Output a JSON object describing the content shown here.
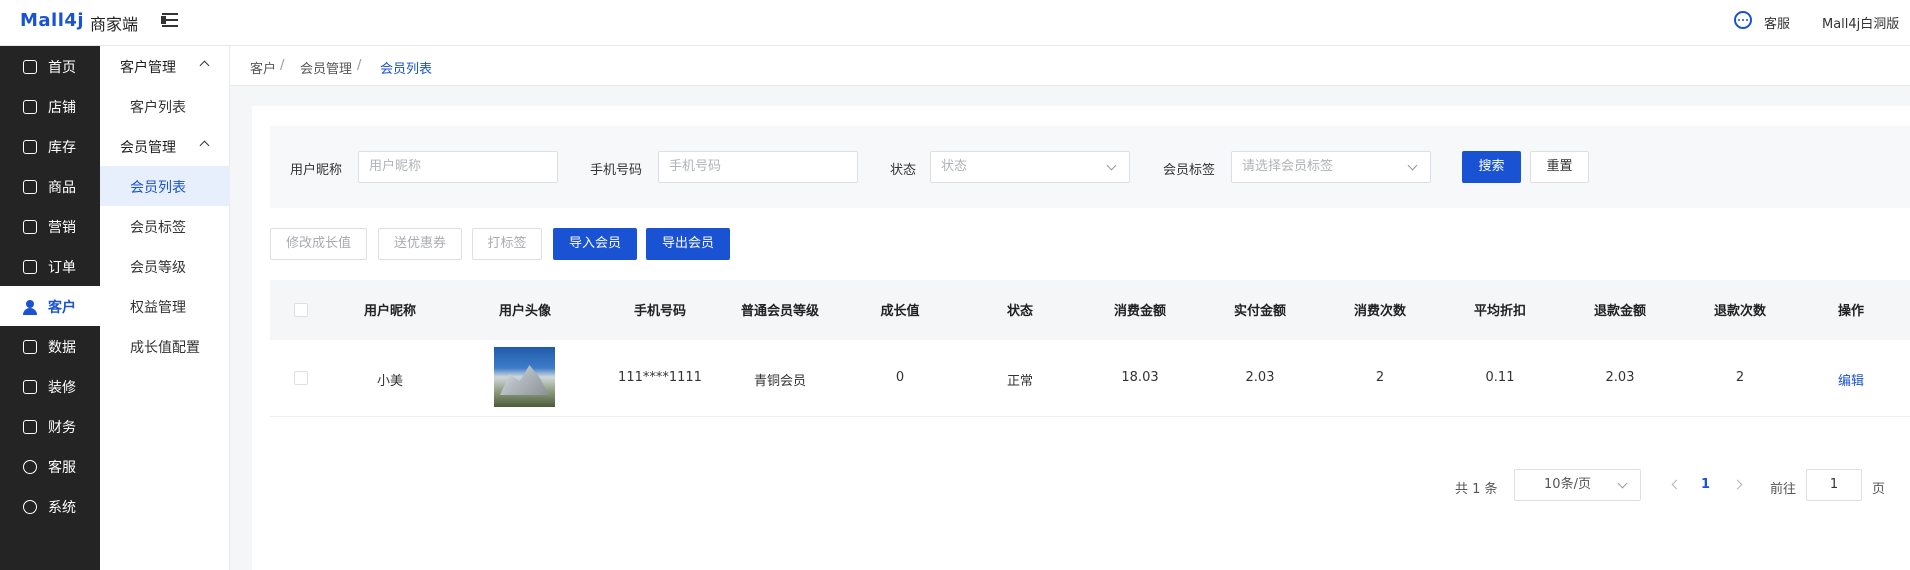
{
  "header": {
    "logo": "Mall4j",
    "subtitle": "商家端",
    "customer_service": "客服",
    "version": "Mall4j白洞版"
  },
  "main_nav": [
    {
      "label": "首页",
      "icon": "home-icon"
    },
    {
      "label": "店铺",
      "icon": "store-icon"
    },
    {
      "label": "库存",
      "icon": "inventory-icon"
    },
    {
      "label": "商品",
      "icon": "product-icon"
    },
    {
      "label": "营销",
      "icon": "gift-icon"
    },
    {
      "label": "订单",
      "icon": "order-icon"
    },
    {
      "label": "客户",
      "icon": "user-icon"
    },
    {
      "label": "数据",
      "icon": "chart-icon"
    },
    {
      "label": "装修",
      "icon": "decorate-icon"
    },
    {
      "label": "财务",
      "icon": "finance-icon"
    },
    {
      "label": "客服",
      "icon": "chat-icon"
    },
    {
      "label": "系统",
      "icon": "settings-icon"
    }
  ],
  "sub_nav": {
    "group1": "客户管理",
    "group1_items": [
      "客户列表"
    ],
    "group2": "会员管理",
    "group2_items": [
      "会员列表",
      "会员标签",
      "会员等级",
      "权益管理",
      "成长值配置"
    ]
  },
  "breadcrumb": [
    "客户",
    "/",
    "会员管理",
    "/",
    "会员列表"
  ],
  "filters": {
    "nickname_label": "用户昵称",
    "nickname_placeholder": "用户昵称",
    "phone_label": "手机号码",
    "phone_placeholder": "手机号码",
    "status_label": "状态",
    "status_placeholder": "状态",
    "tag_label": "会员标签",
    "tag_placeholder": "请选择会员标签",
    "search_btn": "搜索",
    "reset_btn": "重置"
  },
  "actions": {
    "modify_growth": "修改成长值",
    "send_coupon": "送优惠券",
    "tag": "打标签",
    "import": "导入会员",
    "export": "导出会员"
  },
  "table": {
    "columns": [
      "用户昵称",
      "用户头像",
      "手机号码",
      "普通会员等级",
      "成长值",
      "状态",
      "消费金额",
      "实付金额",
      "消费次数",
      "平均折扣",
      "退款金额",
      "退款次数",
      "操作"
    ],
    "rows": [
      {
        "nickname": "小美",
        "phone": "111****1111",
        "level": "青铜会员",
        "growth": "0",
        "status": "正常",
        "consume": "18.03",
        "paid": "2.03",
        "times": "2",
        "discount": "0.11",
        "refund": "2.03",
        "refund_times": "2",
        "op": "编辑"
      }
    ]
  },
  "pagination": {
    "total": "共 1 条",
    "page_size": "10条/页",
    "current": "1",
    "goto": "前往",
    "goto_value": "1",
    "page_unit": "页"
  }
}
